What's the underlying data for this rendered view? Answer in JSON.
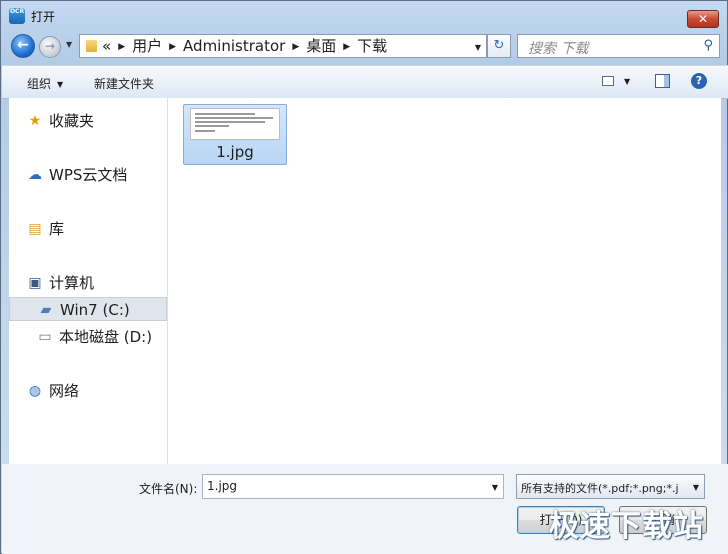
{
  "window": {
    "title": "打开",
    "app_icon_text": "OCR",
    "close_symbol": "✕"
  },
  "nav": {
    "back_symbol": "←",
    "forward_symbol": "→",
    "breadcrumb_prefix": "«",
    "breadcrumbs": [
      "用户",
      "Administrator",
      "桌面",
      "下载"
    ],
    "refresh_symbol": "↻",
    "search_placeholder": "搜索 下载"
  },
  "commandbar": {
    "organize": "组织",
    "new_folder": "新建文件夹"
  },
  "sidebar": {
    "items": [
      {
        "label": "收藏夹",
        "icon": "star-icon"
      },
      {
        "label": "WPS云文档",
        "icon": "cloud-icon"
      },
      {
        "label": "库",
        "icon": "library-icon"
      },
      {
        "label": "计算机",
        "icon": "computer-icon"
      },
      {
        "label": "Win7 (C:)",
        "icon": "system-drive-icon",
        "selected": true
      },
      {
        "label": "本地磁盘 (D:)",
        "icon": "drive-icon"
      },
      {
        "label": "网络",
        "icon": "network-icon"
      }
    ]
  },
  "files": [
    {
      "name": "1.jpg",
      "selected": true
    }
  ],
  "footer": {
    "filename_label": "文件名(N):",
    "filename_value": "1.jpg",
    "filter_value": "所有支持的文件(*.pdf;*.png;*.j",
    "open_label": "打开(O)",
    "cancel_label": "取消"
  },
  "watermark": "极速下载站",
  "colors": {
    "accent": "#2b63b4",
    "selection": "#c3dcf7",
    "close": "#c94a32"
  }
}
